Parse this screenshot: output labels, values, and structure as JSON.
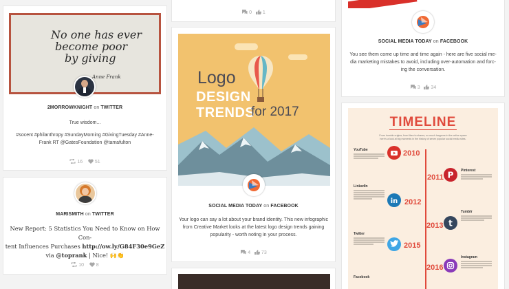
{
  "card1": {
    "quote_lines": [
      "No one has ever",
      "become poor",
      "by giving"
    ],
    "signature": "Anne Frank",
    "author": "2MORROWKNIGHT",
    "on": "on",
    "platform": "TWITTER",
    "text_line1": "True wisdom...",
    "text_line2": "#socent #philanthropy #SundayMorning #GivingTuesday #Anne-",
    "text_line3": "Frank RT @GatesFoundation @tamafulton",
    "retweets": "16",
    "likes": "51"
  },
  "card2": {
    "author": "MARISMITH",
    "on": "on",
    "platform": "TWITTER",
    "line1": "New Report: 5 Statistics You Need to Know on How Con-",
    "line2": "tent Influences Purchases",
    "link": "http://ow.ly/G84F30e9GeZ",
    "line3_pre": "via",
    "mention": "@toprank",
    "line3_post": "| Nice! 🙌👏",
    "retweets": "10",
    "likes": "8"
  },
  "card3": {
    "comments": "0",
    "likes": "1"
  },
  "card4": {
    "title_line1": "Logo",
    "title_line2a": "DESIGN",
    "title_line2b": "TRENDS",
    "title_line3": "for 2017",
    "author": "SOCIAL MEDIA TODAY",
    "on": "on",
    "platform": "FACEBOOK",
    "line1": "Your logo can say a lot about your brand identity. This new infographic",
    "line2": "from Creative Market looks at the latest logo design trends gaining",
    "line3": "popularity - worth noting in your process.",
    "comments": "4",
    "likes": "73"
  },
  "card5": {
    "author": "SOCIAL MEDIA TODAY",
    "on": "on",
    "platform": "FACEBOOK",
    "line1": "You see them come up time and time again - here are five social me-",
    "line2": "dia marketing mistakes to avoid, including over-automation and forc-",
    "line3": "ing the conversation.",
    "comments": "3",
    "likes": "34"
  },
  "timeline": {
    "title": "TIMELINE",
    "intro_line1": "From humble origins, from likes to shares, so much happens in the online space",
    "intro_line2": "here's a look at big moments in the history of seven popular social media sites.",
    "years": [
      "2010",
      "2011",
      "2012",
      "2013",
      "2015",
      "2016"
    ],
    "entries": [
      "YouTube",
      "Pinterest",
      "LinkedIn",
      "Tumblr",
      "Twitter",
      "Instagram",
      "Facebook"
    ]
  },
  "colors": {
    "accent_red": "#e04a3c",
    "timeline_bg": "#fbeee0",
    "logo_bg": "#f2c26e",
    "twitter_blue": "#3fa6e5",
    "linkedin_blue": "#1c79b6",
    "tumblr_navy": "#35465d",
    "pinterest_red": "#c8232c",
    "instagram_purple": "#8a3ab9"
  }
}
